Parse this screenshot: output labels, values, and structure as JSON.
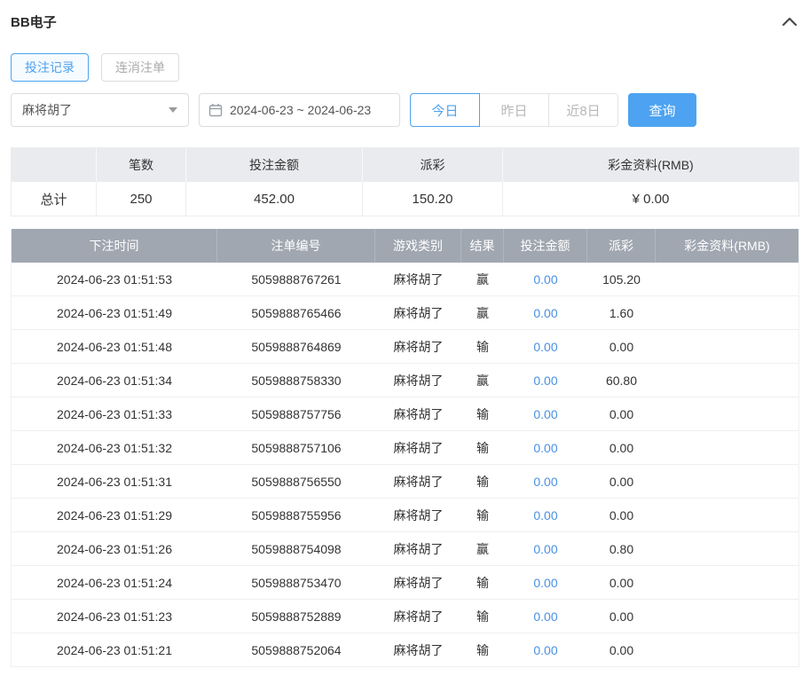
{
  "panel": {
    "title": "BB电子"
  },
  "tabs": [
    {
      "label": "投注记录",
      "active": true
    },
    {
      "label": "连消注单",
      "active": false
    }
  ],
  "filters": {
    "game_select_value": "麻将胡了",
    "date_range_value": "2024-06-23 ~ 2024-06-23",
    "quick": [
      "今日",
      "昨日",
      "近8日"
    ],
    "search_label": "查询"
  },
  "summary": {
    "headers": [
      "",
      "笔数",
      "投注金额",
      "派彩",
      "彩金资料(RMB)"
    ],
    "total": {
      "label": "总计",
      "count": "250",
      "bet_amount": "452.00",
      "payout": "150.20",
      "bonus": "¥ 0.00"
    }
  },
  "table": {
    "headers": [
      "下注时间",
      "注单编号",
      "游戏类别",
      "结果",
      "投注金额",
      "派彩",
      "彩金资料(RMB)"
    ],
    "rows": [
      {
        "time": "2024-06-23 01:51:53",
        "order_id": "5059888767261",
        "game": "麻将胡了",
        "result": "赢",
        "bet": "0.00",
        "payout": "105.20",
        "bonus": ""
      },
      {
        "time": "2024-06-23 01:51:49",
        "order_id": "5059888765466",
        "game": "麻将胡了",
        "result": "赢",
        "bet": "0.00",
        "payout": "1.60",
        "bonus": ""
      },
      {
        "time": "2024-06-23 01:51:48",
        "order_id": "5059888764869",
        "game": "麻将胡了",
        "result": "输",
        "bet": "0.00",
        "payout": "0.00",
        "bonus": ""
      },
      {
        "time": "2024-06-23 01:51:34",
        "order_id": "5059888758330",
        "game": "麻将胡了",
        "result": "赢",
        "bet": "0.00",
        "payout": "60.80",
        "bonus": ""
      },
      {
        "time": "2024-06-23 01:51:33",
        "order_id": "5059888757756",
        "game": "麻将胡了",
        "result": "输",
        "bet": "0.00",
        "payout": "0.00",
        "bonus": ""
      },
      {
        "time": "2024-06-23 01:51:32",
        "order_id": "5059888757106",
        "game": "麻将胡了",
        "result": "输",
        "bet": "0.00",
        "payout": "0.00",
        "bonus": ""
      },
      {
        "time": "2024-06-23 01:51:31",
        "order_id": "5059888756550",
        "game": "麻将胡了",
        "result": "输",
        "bet": "0.00",
        "payout": "0.00",
        "bonus": ""
      },
      {
        "time": "2024-06-23 01:51:29",
        "order_id": "5059888755956",
        "game": "麻将胡了",
        "result": "输",
        "bet": "0.00",
        "payout": "0.00",
        "bonus": ""
      },
      {
        "time": "2024-06-23 01:51:26",
        "order_id": "5059888754098",
        "game": "麻将胡了",
        "result": "赢",
        "bet": "0.00",
        "payout": "0.80",
        "bonus": ""
      },
      {
        "time": "2024-06-23 01:51:24",
        "order_id": "5059888753470",
        "game": "麻将胡了",
        "result": "输",
        "bet": "0.00",
        "payout": "0.00",
        "bonus": ""
      },
      {
        "time": "2024-06-23 01:51:23",
        "order_id": "5059888752889",
        "game": "麻将胡了",
        "result": "输",
        "bet": "0.00",
        "payout": "0.00",
        "bonus": ""
      },
      {
        "time": "2024-06-23 01:51:21",
        "order_id": "5059888752064",
        "game": "麻将胡了",
        "result": "输",
        "bet": "0.00",
        "payout": "0.00",
        "bonus": ""
      }
    ]
  },
  "colors": {
    "accent": "#4da3f1",
    "link": "#4a90e2",
    "table_header_bg": "#a0a7b1",
    "summary_header_bg": "#e9ebee"
  }
}
